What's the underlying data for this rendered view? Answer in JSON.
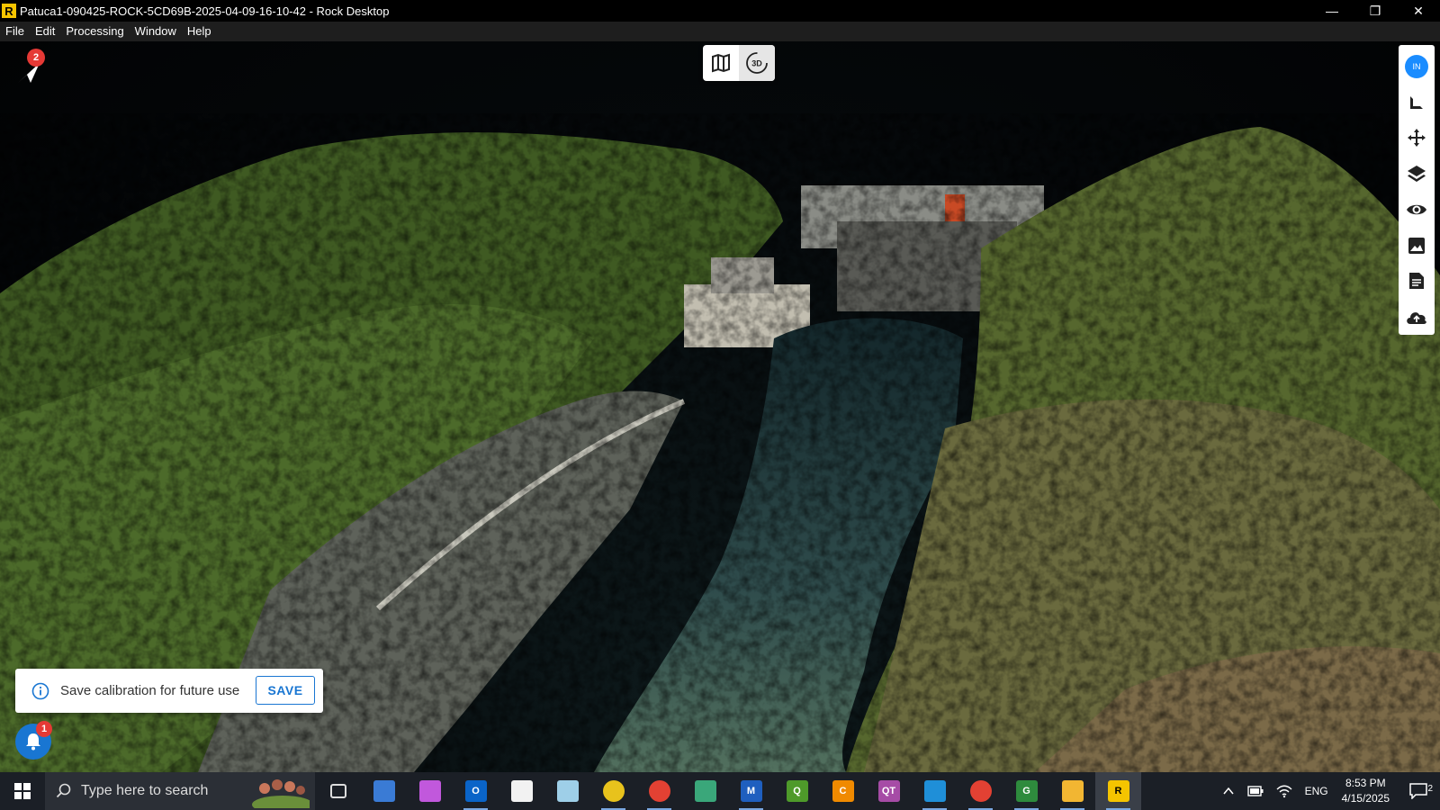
{
  "window": {
    "title": "Patuca1-090425-ROCK-5CD69B-2025-04-09-16-10-42 - Rock Desktop",
    "logo_letter": "R",
    "minimize": "—",
    "maximize": "❐",
    "close": "✕"
  },
  "menu": [
    "File",
    "Edit",
    "Processing",
    "Window",
    "Help"
  ],
  "view_toggle": {
    "map_icon": "map-icon",
    "three_d_label": "3D",
    "active": "3D"
  },
  "send_badge": "2",
  "right_toolbar": {
    "avatar_initials": "IN",
    "tools": [
      "measure-icon",
      "move-icon",
      "layers-icon",
      "visibility-icon",
      "image-icon",
      "report-icon",
      "cloud-upload-icon"
    ]
  },
  "toast": {
    "message": "Save calibration for future use",
    "action": "SAVE"
  },
  "notifications_badge": "1",
  "taskbar": {
    "search_placeholder": "Type here to search",
    "apps": [
      {
        "name": "task-view",
        "label": "",
        "color": "#1b1f26"
      },
      {
        "name": "remote-desktop",
        "label": "",
        "color": "#3a7bd5"
      },
      {
        "name": "copilot",
        "label": "",
        "color": "#c158dc"
      },
      {
        "name": "outlook",
        "label": "O",
        "color": "#0a64c8"
      },
      {
        "name": "file",
        "label": "",
        "color": "#f2f2f2"
      },
      {
        "name": "notes",
        "label": "",
        "color": "#9ecfe8"
      },
      {
        "name": "sketch",
        "label": "",
        "color": "#e8c21c"
      },
      {
        "name": "chrome",
        "label": "",
        "color": "#e34133"
      },
      {
        "name": "mail",
        "label": "",
        "color": "#3aa77a"
      },
      {
        "name": "maple",
        "label": "M",
        "color": "#1f5fbf"
      },
      {
        "name": "qgis",
        "label": "Q",
        "color": "#4e9a2a"
      },
      {
        "name": "c-app",
        "label": "C",
        "color": "#f08a00"
      },
      {
        "name": "qt-app",
        "label": "QT",
        "color": "#a64ca6"
      },
      {
        "name": "download-app",
        "label": "",
        "color": "#1f8fd8"
      },
      {
        "name": "chrome-2",
        "label": "",
        "color": "#e34133"
      },
      {
        "name": "green-app",
        "label": "G",
        "color": "#2e8b3d"
      },
      {
        "name": "explorer",
        "label": "",
        "color": "#f2b632"
      },
      {
        "name": "rock-app",
        "label": "R",
        "color": "#f5c400"
      }
    ],
    "tray": {
      "lang": "ENG",
      "time": "8:53 PM",
      "date": "4/15/2025",
      "action_badge": "2"
    }
  }
}
